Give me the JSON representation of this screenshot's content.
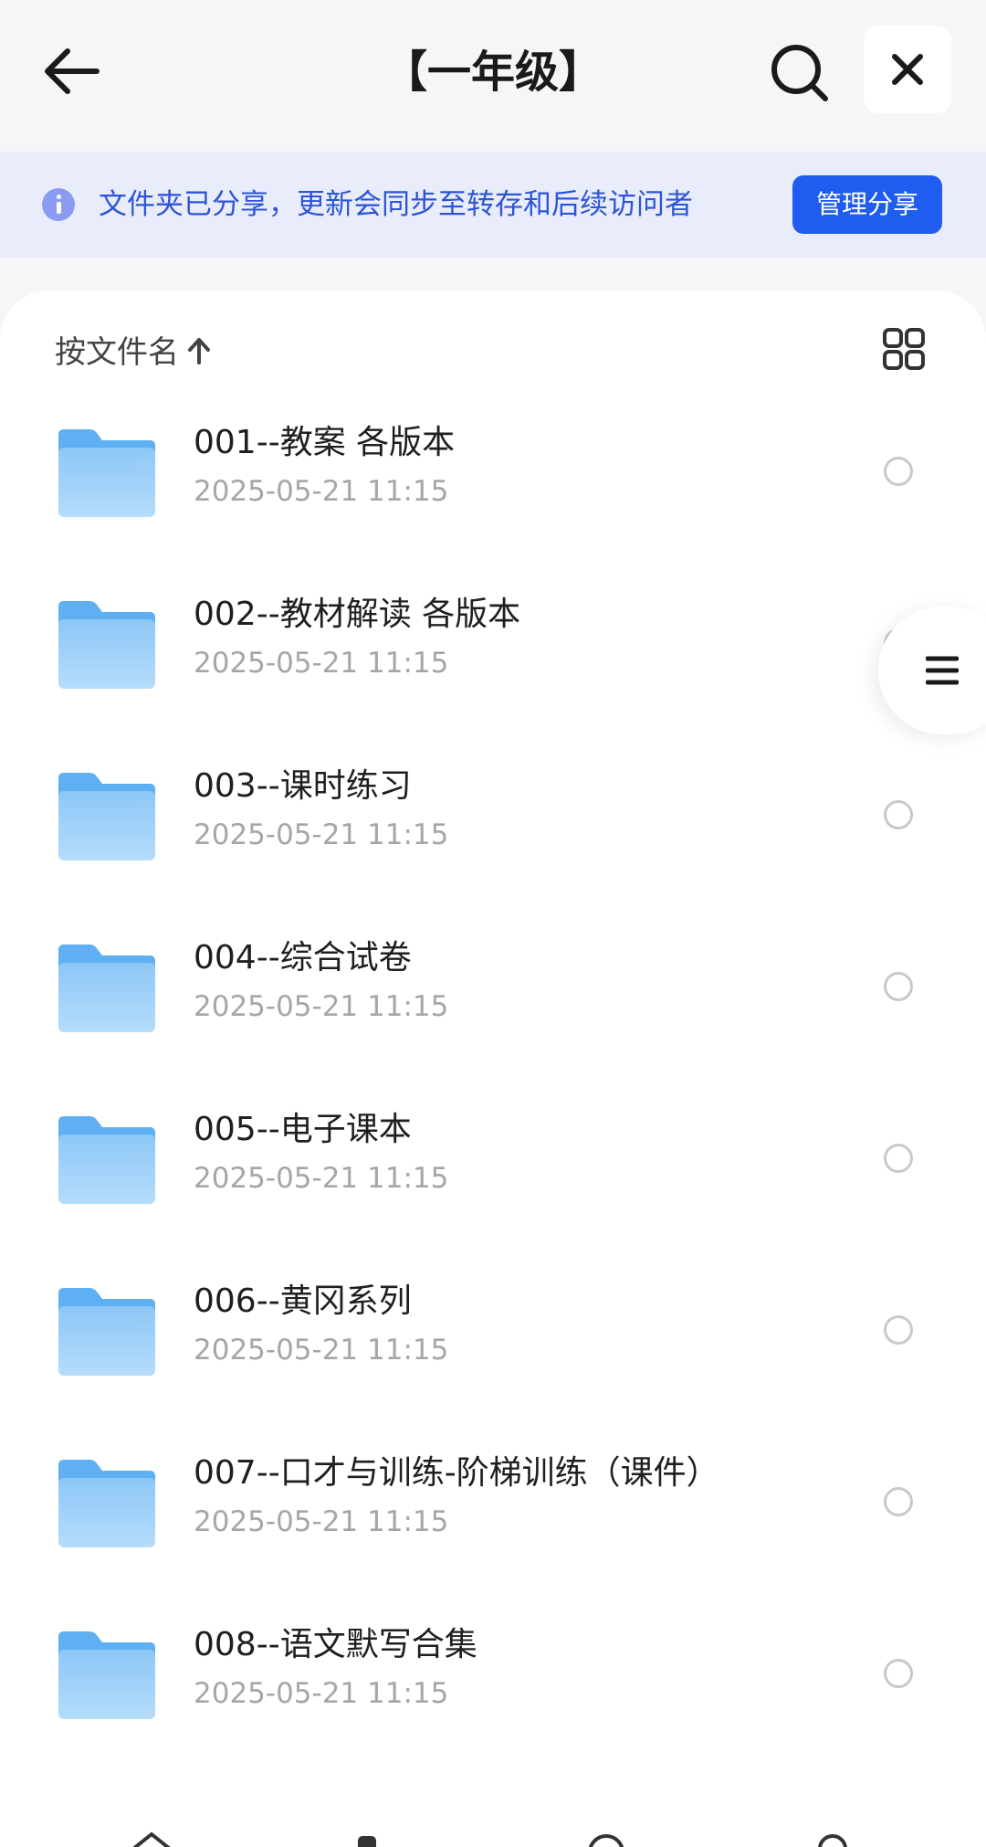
{
  "header": {
    "title": "【一年级】",
    "back_icon": "arrow-left-icon",
    "search_icon": "search-icon",
    "close_icon": "close-icon"
  },
  "banner": {
    "info_icon": "info-icon",
    "message": "文件夹已分享，更新会同步至转存和后续访问者",
    "manage_label": "管理分享",
    "accent_color": "#1f5cf0"
  },
  "sort": {
    "label": "按文件名",
    "direction_icon": "arrow-up-icon",
    "view_toggle_icon": "grid-view-icon"
  },
  "files": [
    {
      "name": "001--教案  各版本",
      "date": "2025-05-21 11:15",
      "icon": "folder-icon"
    },
    {
      "name": "002--教材解读  各版本",
      "date": "2025-05-21 11:15",
      "icon": "folder-icon"
    },
    {
      "name": "003--课时练习",
      "date": "2025-05-21 11:15",
      "icon": "folder-icon"
    },
    {
      "name": "004--综合试卷",
      "date": "2025-05-21 11:15",
      "icon": "folder-icon"
    },
    {
      "name": "005--电子课本",
      "date": "2025-05-21 11:15",
      "icon": "folder-icon"
    },
    {
      "name": "006--黄冈系列",
      "date": "2025-05-21 11:15",
      "icon": "folder-icon"
    },
    {
      "name": "007--口才与训练-阶梯训练（课件）",
      "date": "2025-05-21 11:15",
      "icon": "folder-icon"
    },
    {
      "name": "008--语文默写合集",
      "date": "2025-05-21 11:15",
      "icon": "folder-icon"
    }
  ],
  "floating_menu": {
    "icon": "menu-icon"
  }
}
